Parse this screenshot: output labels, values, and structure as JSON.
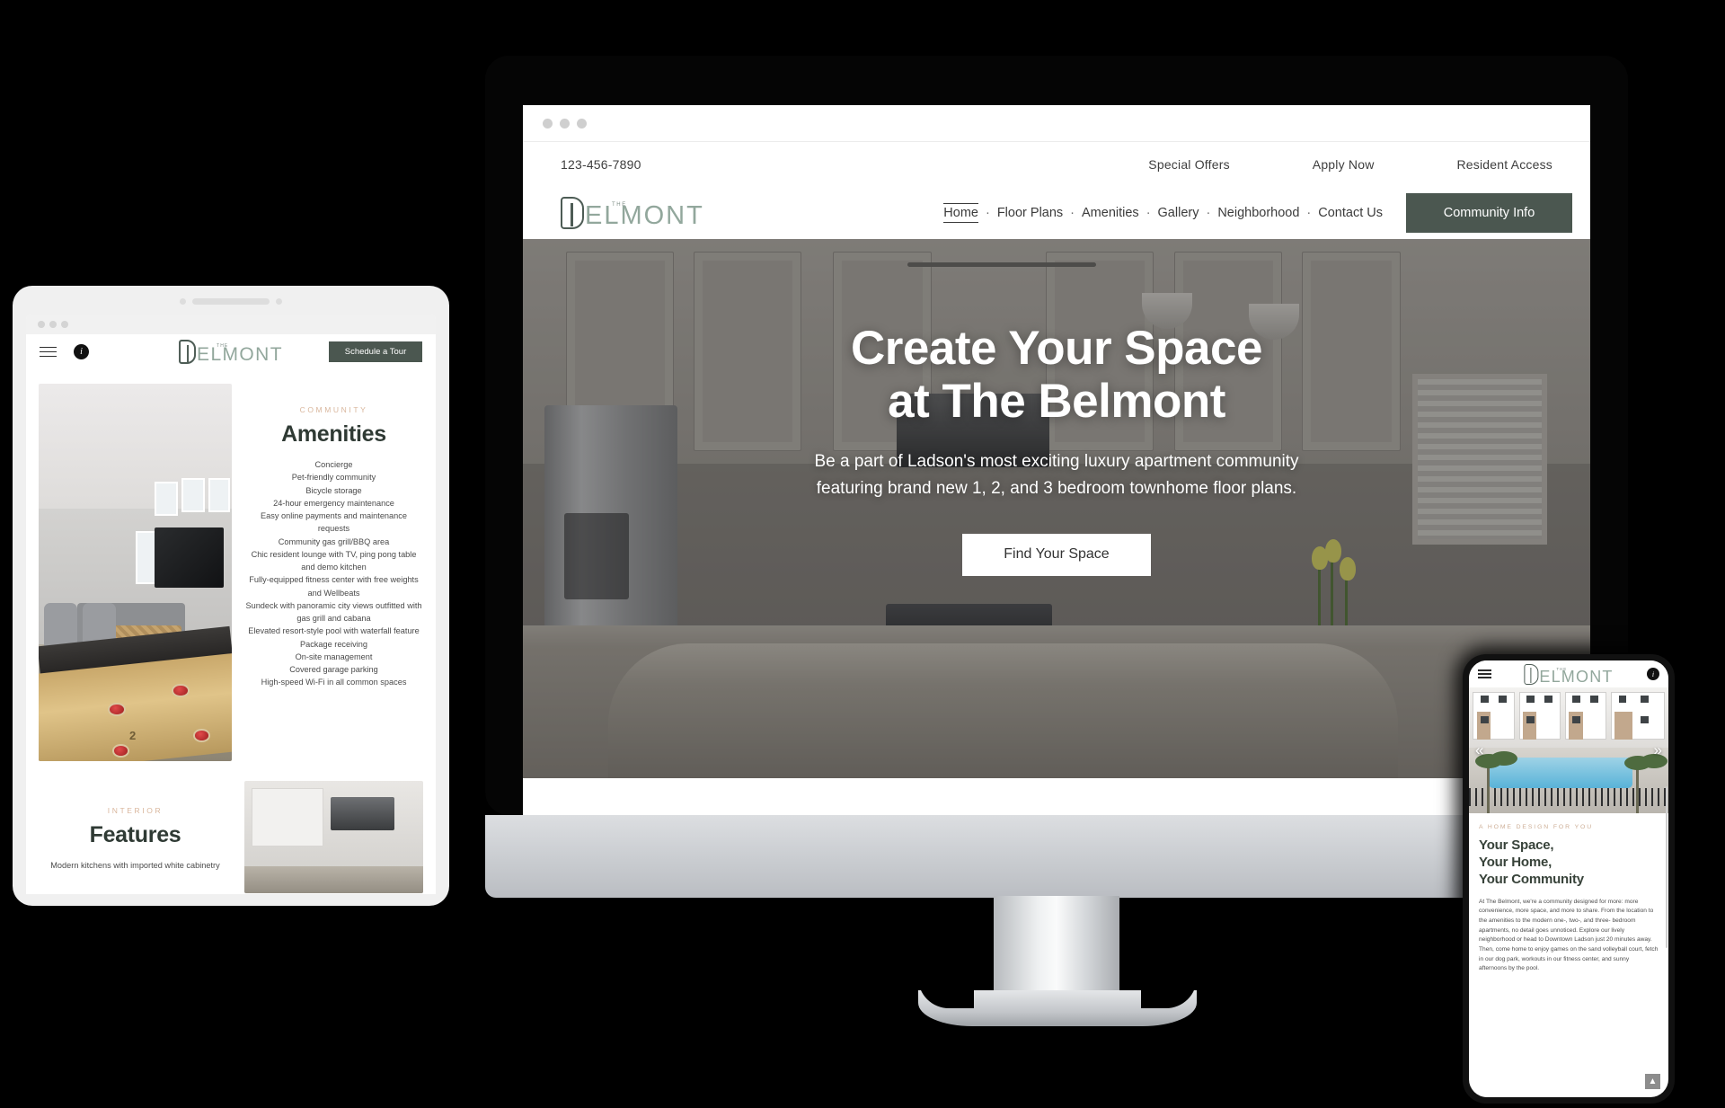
{
  "brand": {
    "logo_the": "THE",
    "logo_word": "ELMONT",
    "accent_green": "#4b5750",
    "accent_tan": "#d9b69c"
  },
  "desktop": {
    "browser": {
      "dots": 3
    },
    "utility_bar": {
      "phone": "123-456-7890",
      "links": [
        "Special Offers",
        "Apply Now",
        "Resident Access"
      ]
    },
    "nav": {
      "items": [
        "Home",
        "Floor Plans",
        "Amenities",
        "Gallery",
        "Neighborhood",
        "Contact Us"
      ],
      "active": "Home",
      "separator": "·",
      "cta_label": "Community Info"
    },
    "hero": {
      "title_line1": "Create Your Space",
      "title_line2": "at The Belmont",
      "subtitle_line1": "Be a part of Ladson's most exciting luxury apartment community",
      "subtitle_line2": "featuring brand new 1, 2, and 3 bedroom townhome floor plans.",
      "button_label": "Find Your Space"
    }
  },
  "tablet": {
    "header": {
      "menu_icon": "hamburger-icon",
      "info_icon": "info-icon",
      "tour_button": "Schedule a Tour"
    },
    "ghost_heading": "Amenities",
    "amenities": {
      "eyebrow": "COMMUNITY",
      "heading": "Amenities",
      "items": [
        "Concierge",
        "Pet-friendly community",
        "Bicycle storage",
        "24-hour emergency maintenance",
        "Easy online payments and maintenance requests",
        "Community gas grill/BBQ area",
        "Chic resident lounge with TV, ping pong table and demo kitchen",
        "Fully-equipped fitness center with free weights and Wellbeats",
        "Sundeck with panoramic city views outfitted with gas grill and cabana",
        "Elevated resort-style pool with waterfall feature",
        "Package receiving",
        "On-site management",
        "Covered garage parking",
        "High-speed Wi-Fi in all common spaces"
      ]
    },
    "features": {
      "eyebrow": "INTERIOR",
      "heading": "Features",
      "text": "Modern kitchens with imported white cabinetry"
    }
  },
  "phone": {
    "header": {
      "menu_icon": "hamburger-icon",
      "info_icon": "info-icon"
    },
    "carousel": {
      "prev": "«",
      "next": "»"
    },
    "eyebrow": "A HOME DESIGN FOR YOU",
    "heading_line1": "Your Space,",
    "heading_line2": "Your Home,",
    "heading_line3": "Your Community",
    "body": "At The Belmont, we're a community designed for more: more convenience, more space, and more to share. From the location to the amenities to the modern one-, two-, and three- bedroom apartments, no detail goes unnoticed. Explore our lively neighborhood or head to Downtown Ladson just 20 minutes away. Then, come home to enjoy games on the sand volleyball court, fetch in our dog park, workouts in our fitness center, and sunny afternoons by the pool.",
    "scroll_top_icon": "chevron-up-icon"
  }
}
